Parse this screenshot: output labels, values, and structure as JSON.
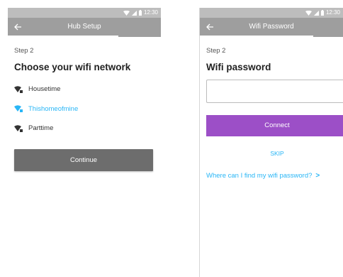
{
  "status_bar": {
    "time": "12:30"
  },
  "hub_setup": {
    "title": "Hub Setup",
    "step": "Step 2",
    "heading": "Choose your wifi network",
    "networks": [
      {
        "name": "Housetime",
        "selected": false
      },
      {
        "name": "Thishomeofmine",
        "selected": true
      },
      {
        "name": "Parttime",
        "selected": false
      }
    ],
    "continue_label": "Continue"
  },
  "wifi_password": {
    "title": "Wifi Password",
    "step": "Step 2",
    "heading": "Wifi password",
    "password_value": "",
    "connect_label": "Connect",
    "skip_label": "SKIP",
    "help_link": "Where can I find my wifi password?",
    "help_chevron": ">"
  },
  "colors": {
    "appbar": "#9e9e9e",
    "statusbar": "#bdbdbd",
    "selected_network": "#29b6f6",
    "continue_button": "#6d6d6d",
    "connect_button": "#9c4fc7",
    "link": "#29b6f6"
  },
  "icons": [
    "back-arrow-icon",
    "wifi-icon",
    "signal-icon",
    "battery-icon"
  ]
}
